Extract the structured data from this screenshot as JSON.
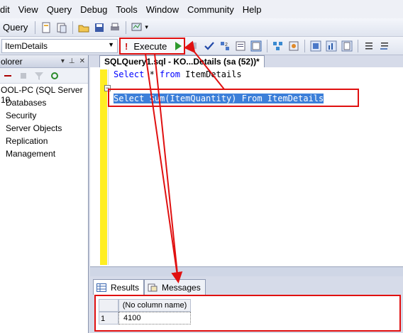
{
  "menu": [
    "dit",
    "View",
    "Query",
    "Debug",
    "Tools",
    "Window",
    "Community",
    "Help"
  ],
  "toolbar1": {
    "partial_label": "Query"
  },
  "toolbar2": {
    "database_selected": "ItemDetails",
    "execute_label": "Execute"
  },
  "explorer": {
    "title": "olorer",
    "server": "OOL-PC (SQL Server 10.",
    "nodes": [
      "Databases",
      "Security",
      "Server Objects",
      "Replication",
      "Management"
    ]
  },
  "editor": {
    "tab_title": "SQLQuery1.sql - KO...Details (sa (52))*",
    "line1_kw1": "Select",
    "line1_rest": " * ",
    "line1_kw2": "from",
    "line1_obj": " ItemDetails",
    "line3_kw1": "Select",
    "line3_mid": " Sum(ItemQuantity) ",
    "line3_kw2": "From",
    "line3_obj": " ItemDetails"
  },
  "results": {
    "tabs": [
      "Results",
      "Messages"
    ],
    "column_header": "(No column name)",
    "row_number": "1",
    "value": "4100"
  },
  "colors": {
    "annotation_red": "#e01010",
    "keyword_blue": "#0000ff",
    "selection_blue": "#3c7fd9",
    "gutter_yellow": "#ffee22"
  }
}
